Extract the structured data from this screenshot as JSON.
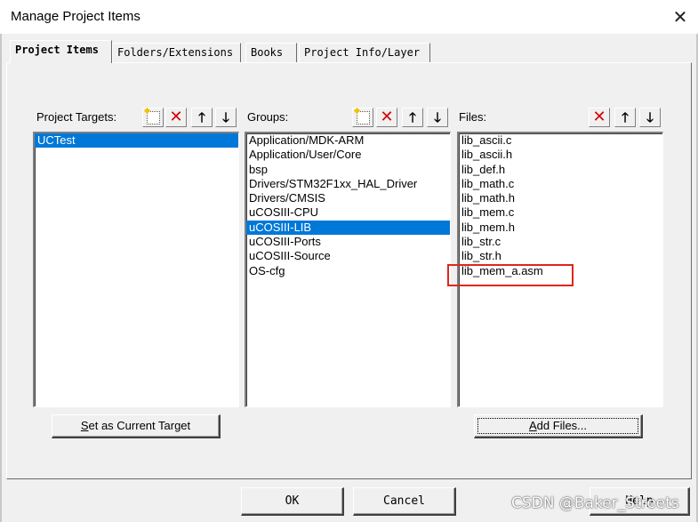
{
  "window": {
    "title": "Manage Project Items",
    "close_glyph": "✕"
  },
  "tabs": [
    {
      "label": "Project Items",
      "active": true
    },
    {
      "label": "Folders/Extensions",
      "active": false
    },
    {
      "label": "Books",
      "active": false
    },
    {
      "label": "Project Info/Layer",
      "active": false
    }
  ],
  "targets": {
    "label": "Project Targets:",
    "items": [
      "UCTest"
    ],
    "selected": "UCTest",
    "toolbar": [
      "new-icon",
      "delete-icon",
      "move-up-icon",
      "move-down-icon"
    ]
  },
  "groups": {
    "label": "Groups:",
    "items": [
      "Application/MDK-ARM",
      "Application/User/Core",
      "bsp",
      "Drivers/STM32F1xx_HAL_Driver",
      "Drivers/CMSIS",
      "uCOSIII-CPU",
      "uCOSIII-LIB",
      "uCOSIII-Ports",
      "uCOSIII-Source",
      "OS-cfg"
    ],
    "selected": "uCOSIII-LIB",
    "toolbar": [
      "new-icon",
      "delete-icon",
      "move-up-icon",
      "move-down-icon"
    ]
  },
  "files": {
    "label": "Files:",
    "items": [
      "lib_ascii.c",
      "lib_ascii.h",
      "lib_def.h",
      "lib_math.c",
      "lib_math.h",
      "lib_mem.c",
      "lib_mem.h",
      "lib_str.c",
      "lib_str.h",
      "lib_mem_a.asm"
    ],
    "highlighted": "lib_mem_a.asm",
    "highlight_color": "#e0251b",
    "toolbar": [
      "delete-icon",
      "move-up-icon",
      "move-down-icon"
    ]
  },
  "buttons": {
    "set_current_target": "Set as Current Target",
    "set_current_target_mnemonic": "S",
    "add_files": "Add Files...",
    "add_files_mnemonic": "A",
    "ok": "OK",
    "cancel": "Cancel",
    "help": "Help"
  },
  "watermark": "CSDN @Baker_Streets",
  "colors": {
    "selection": "#0078d7",
    "delete": "#d20000"
  }
}
